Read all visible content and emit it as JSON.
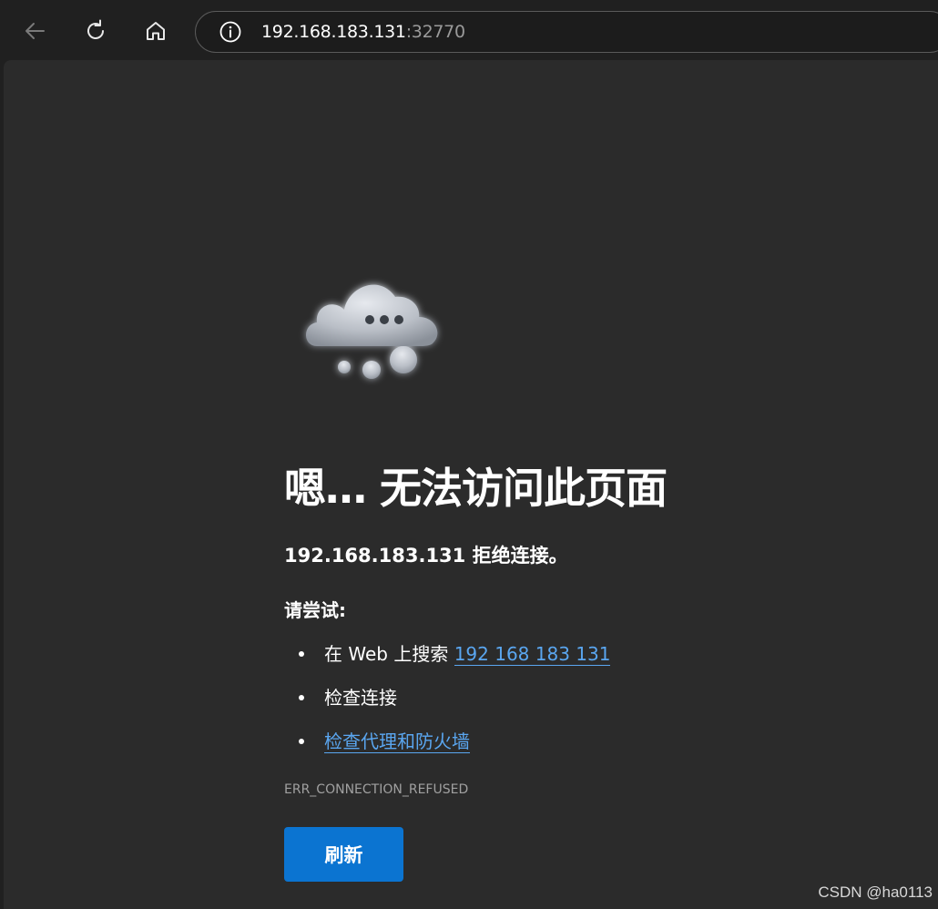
{
  "browser": {
    "back_icon": "arrow-left-icon",
    "reload_icon": "reload-icon",
    "home_icon": "home-icon",
    "info_icon": "info-icon",
    "address": {
      "host": "192.168.183.131",
      "port": ":32770"
    }
  },
  "error_page": {
    "illustration_icon": "cloud-icon",
    "title": "嗯… 无法访问此页面",
    "subtitle": "192.168.183.131 拒绝连接。",
    "try_label": "请尝试:",
    "suggestions": {
      "search_prefix": "在 Web 上搜索 ",
      "search_link": "192 168 183 131",
      "check_connection": "检查连接",
      "check_proxy_link": "检查代理和防火墙"
    },
    "error_code": "ERR_CONNECTION_REFUSED",
    "refresh_label": "刷新",
    "accent_color": "#0b74d1",
    "link_color": "#5aa6f0"
  },
  "watermark": "CSDN @ha0113"
}
